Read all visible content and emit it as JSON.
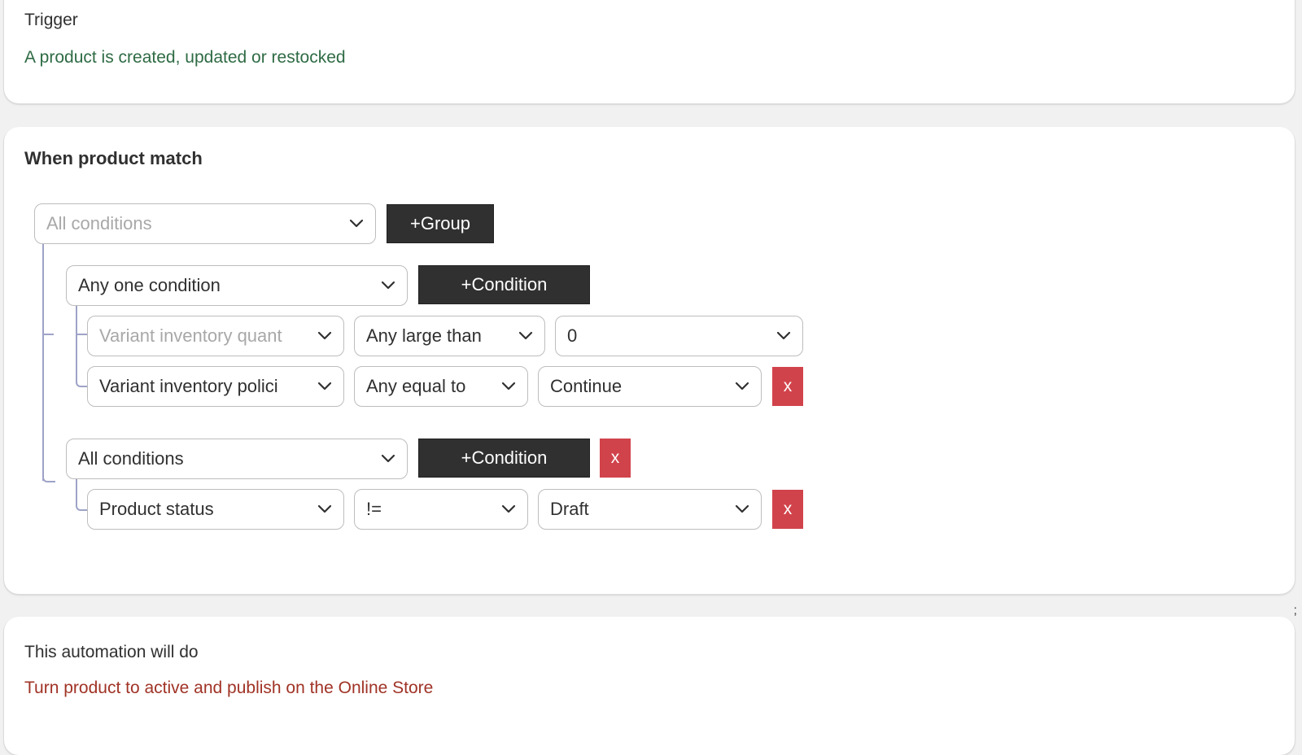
{
  "trigger": {
    "heading": "Trigger",
    "description": "A product is created, updated or restocked"
  },
  "match": {
    "heading": "When product match",
    "root": {
      "selector": "All conditions",
      "add_group_label": "+Group"
    },
    "groups": [
      {
        "selector": "Any one condition",
        "add_condition_label": "+Condition",
        "conditions": [
          {
            "field": "Variant inventory quant",
            "operator": "Any large than",
            "value": "0",
            "field_placeholder": true
          },
          {
            "field": "Variant inventory polici",
            "operator": "Any equal to",
            "value": "Continue",
            "remove_label": "x"
          }
        ]
      },
      {
        "selector": "All conditions",
        "add_condition_label": "+Condition",
        "remove_label": "x",
        "conditions": [
          {
            "field": "Product status",
            "operator": "!=",
            "value": "Draft",
            "remove_label": "x"
          }
        ]
      }
    ]
  },
  "action": {
    "heading": "This automation will do",
    "description": "Turn product to active and publish on the Online Store"
  },
  "colors": {
    "trigger_text": "#2e6b44",
    "action_text": "#a03326",
    "dark_button": "#303030",
    "remove_button": "#d1434b",
    "tree_line": "#9ea3c7"
  }
}
